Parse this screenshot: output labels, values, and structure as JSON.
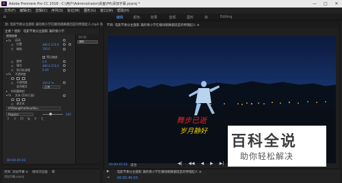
{
  "window": {
    "title": "Adobe Premiere Pro CC 2018 - C:\\用户\\Administrator\\桌面\\PR\\添加字幕.prproj *",
    "controls": [
      "—",
      "□",
      "✕"
    ]
  },
  "menubar": [
    "文件(F)",
    "编辑(E)",
    "剪辑(C)",
    "序列(S)",
    "标记(M)",
    "图形(G)",
    "窗口(W)",
    "帮助(H)"
  ],
  "workspaces": [
    "编辑",
    "颜色",
    "效果",
    "音频",
    "图形",
    "库",
    "Editing"
  ],
  "left_panel": {
    "tab_row": "源: 电影节奏分主题影 满的情小学在播场跳舞都因是的特镜起人.mp4   效果控件",
    "source_label": "主要 * 图形",
    "sequence_label": "电影节奏分主题影 满的情小学",
    "mini_timeline": {
      "time": "00:00",
      "clip_label": "图形"
    },
    "rows": {
      "video_header": "视频效果",
      "transform": "运动",
      "position": "位置",
      "position_val": "480.0   270.0",
      "scale": "缩放",
      "scale_val": "100.0",
      "uniform_scale": "等比缩放",
      "rotation": "旋转",
      "rotation_val": "0.0",
      "anchor": "锚点",
      "anchor_val": "480.0   270.0",
      "antiflicker": "防闪烁滤镜",
      "antiflicker_val": "0.00",
      "opacity_header": "不透明度",
      "opacity": "不透明度",
      "opacity_val": "100.0 %",
      "blend": "混合模式",
      "blend_val": "正常",
      "time_remap": "时间重映射",
      "text_header": "文本 (百年已逝)",
      "source_text": "源文本",
      "font_value": "HYDiangGheShouShu...",
      "style_value": "Regular",
      "size_val": "100"
    },
    "format_buttons": [
      "T",
      "T",
      "TT",
      "Tt",
      "T'",
      "T,"
    ],
    "timecode": "00:00:45:03"
  },
  "program_monitor": {
    "tab": "节目: 电影节奏分主题影 满的情小学在播场跳舞都因是的特镜起人 ≡",
    "caption_line1": "舞步已逝",
    "caption_line2": "岁月静好",
    "timecode": "00:00:45:03",
    "fit": "适合"
  },
  "transport": [
    "◀|",
    "◀◀",
    "◀",
    "▶",
    "▶|",
    "▶▶",
    "⊞",
    "◫",
    "⊡"
  ],
  "bottom_left": {
    "tabs": [
      "项目: 添加字幕 ≡",
      "媒体浏览器",
      "库"
    ],
    "sub": "添加字幕.prproj"
  },
  "bottom_right": {
    "tab": "电影节奏分主题影 满的情小学在播场跳舞都因是的特镜起人 ≡",
    "timecode": "00:00:45:03"
  },
  "tools": [
    "▶",
    "⇥",
    "⇔",
    "◆"
  ],
  "watermark": {
    "big": "百科全说",
    "small": "助你轻松解决"
  },
  "colors": {
    "accent_blue": "#4d8fff",
    "caption_red": "#d8262c",
    "caption_yellow": "#e8c600"
  }
}
